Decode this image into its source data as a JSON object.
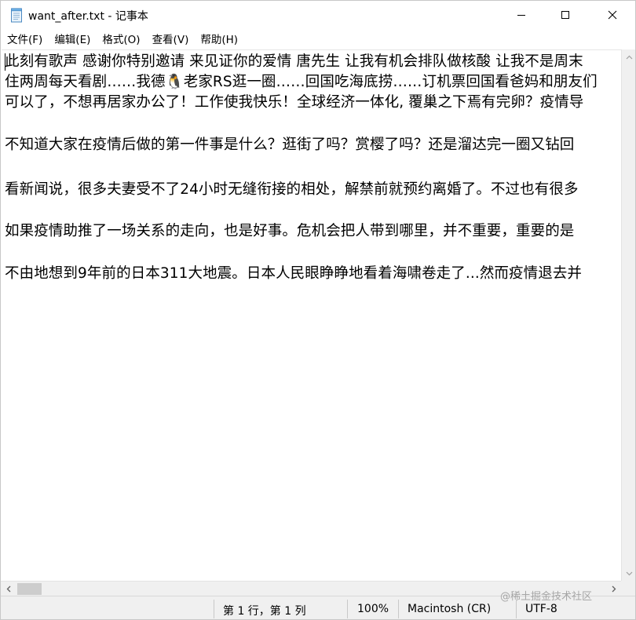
{
  "window": {
    "title": "want_after.txt - 记事本"
  },
  "menu": {
    "items": [
      "文件(F)",
      "编辑(E)",
      "格式(O)",
      "查看(V)",
      "帮助(H)"
    ]
  },
  "editor": {
    "lines": [
      "此刻有歌声 感谢你特别邀请 来见证你的爱情 唐先生 让我有机会排队做核酸 让我不是周末",
      "住两周每天看剧……我德🐧老家RS逛一圈……回国吃海底捞……订机票回国看爸妈和朋友们",
      "可以了，不想再居家办公了！工作使我快乐！全球经济一体化, 覆巢之下焉有完卵？疫情导",
      "",
      "不知道大家在疫情后做的第一件事是什么？逛街了吗？赏樱了吗？还是溜达完一圈又钻回",
      "",
      "看新闻说，很多夫妻受不了24小时无缝衔接的相处，解禁前就预约离婚了。不过也有很多",
      "",
      "如果疫情助推了一场关系的走向，也是好事。危机会把人带到哪里，并不重要，重要的是",
      "",
      "不由地想到9年前的日本311大地震。日本人民眼睁睁地看着海啸卷走了...然而疫情退去并"
    ]
  },
  "status": {
    "position": "第 1 行，第 1 列",
    "zoom": "100%",
    "line_ending": "Macintosh (CR)",
    "encoding": "UTF-8"
  },
  "watermark": "@稀土掘金技术社区"
}
